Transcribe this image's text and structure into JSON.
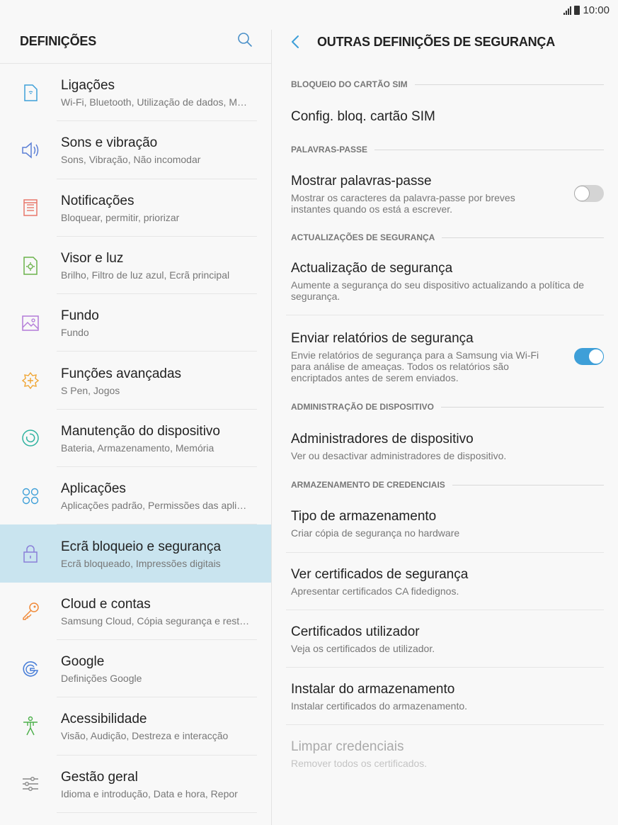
{
  "status": {
    "time": "10:00"
  },
  "left": {
    "title": "DEFINIÇÕES",
    "items": [
      {
        "title": "Ligações",
        "subtitle": "Wi-Fi, Bluetooth, Utilização de dados, M…",
        "icon": "connections-icon"
      },
      {
        "title": "Sons e vibração",
        "subtitle": "Sons, Vibração, Não incomodar",
        "icon": "sound-icon"
      },
      {
        "title": "Notificações",
        "subtitle": "Bloquear, permitir, priorizar",
        "icon": "notifications-icon"
      },
      {
        "title": "Visor e luz",
        "subtitle": "Brilho, Filtro de luz azul, Ecrã principal",
        "icon": "display-icon"
      },
      {
        "title": "Fundo",
        "subtitle": "Fundo",
        "icon": "wallpaper-icon"
      },
      {
        "title": "Funções avançadas",
        "subtitle": "S Pen, Jogos",
        "icon": "advanced-features-icon"
      },
      {
        "title": "Manutenção do dispositivo",
        "subtitle": "Bateria, Armazenamento, Memória",
        "icon": "device-maintenance-icon"
      },
      {
        "title": "Aplicações",
        "subtitle": "Aplicações padrão, Permissões das apli…",
        "icon": "apps-icon"
      },
      {
        "title": "Ecrã bloqueio e segurança",
        "subtitle": "Ecrã bloqueado, Impressões digitais",
        "icon": "lock-icon"
      },
      {
        "title": "Cloud e contas",
        "subtitle": "Samsung Cloud, Cópia segurança e rest…",
        "icon": "key-icon"
      },
      {
        "title": "Google",
        "subtitle": "Definições Google",
        "icon": "google-icon"
      },
      {
        "title": "Acessibilidade",
        "subtitle": "Visão, Audição, Destreza e interacção",
        "icon": "accessibility-icon"
      },
      {
        "title": "Gestão geral",
        "subtitle": "Idioma e introdução, Data e hora, Repor",
        "icon": "general-management-icon"
      }
    ],
    "active_index": 8
  },
  "right": {
    "title": "OUTRAS DEFINIÇÕES DE SEGURANÇA",
    "sections": {
      "sim": "BLOQUEIO DO CARTÃO SIM",
      "passwords": "PALAVRAS-PASSE",
      "updates": "ACTUALIZAÇÕES DE SEGURANÇA",
      "admin": "ADMINISTRAÇÃO DE DISPOSITIVO",
      "credentials": "ARMAZENAMENTO DE CREDENCIAIS"
    },
    "rows": {
      "sim_lock": {
        "title": "Config. bloq. cartão SIM"
      },
      "show_passwords": {
        "title": "Mostrar palavras-passe",
        "subtitle": "Mostrar os caracteres da palavra-passe por breves instantes quando os está a escrever.",
        "toggle": "off"
      },
      "security_update": {
        "title": "Actualização de segurança",
        "subtitle": "Aumente a segurança do seu dispositivo actualizando a política de segurança."
      },
      "security_reports": {
        "title": "Enviar relatórios de segurança",
        "subtitle": "Envie relatórios de segurança para a Samsung via Wi-Fi para análise de ameaças. Todos os relatórios são encriptados antes de serem enviados.",
        "toggle": "on"
      },
      "device_admins": {
        "title": "Administradores de dispositivo",
        "subtitle": "Ver ou desactivar administradores de dispositivo."
      },
      "storage_type": {
        "title": "Tipo de armazenamento",
        "subtitle": "Criar cópia de segurança no hardware"
      },
      "view_certs": {
        "title": "Ver certificados de segurança",
        "subtitle": "Apresentar certificados CA fidedignos."
      },
      "user_certs": {
        "title": "Certificados utilizador",
        "subtitle": "Veja os certificados de utilizador."
      },
      "install_storage": {
        "title": "Instalar do armazenamento",
        "subtitle": "Instalar certificados do armazenamento."
      },
      "clear_credentials": {
        "title": "Limpar credenciais",
        "subtitle": "Remover todos os certificados."
      }
    }
  },
  "colors": {
    "accent": "#3e9fd8",
    "active_bg": "#c9e4ef"
  }
}
